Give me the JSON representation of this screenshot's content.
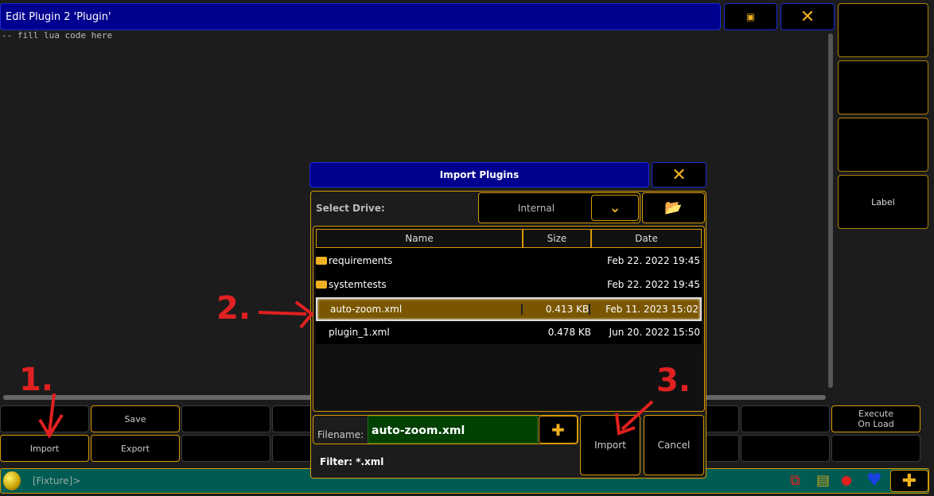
{
  "window": {
    "title": "Edit Plugin 2 'Plugin'",
    "code": "-- fill lua code here"
  },
  "sidebar": {
    "buttons": [
      "",
      "",
      "",
      "Label"
    ]
  },
  "grid": {
    "row1": [
      "",
      "Save",
      "",
      "",
      "",
      "",
      "",
      "",
      "",
      "Execute On Load"
    ],
    "row2": [
      "Import",
      "Export",
      "",
      "",
      "",
      "",
      "",
      "",
      "",
      ""
    ]
  },
  "command_line": {
    "prompt": "[Fixture]>"
  },
  "dialog": {
    "title": "Import Plugins",
    "select_drive_label": "Select Drive:",
    "drive_value": "Internal",
    "columns": [
      "Name",
      "Size",
      "Date"
    ],
    "files": [
      {
        "name": "requirements",
        "size": "",
        "date": "Feb 22. 2022 19:45",
        "type": "folder"
      },
      {
        "name": "systemtests",
        "size": "",
        "date": "Feb 22. 2022 19:45",
        "type": "folder"
      },
      {
        "name": "auto-zoom.xml",
        "size": "0.413 KB",
        "date": "Feb 11. 2023 15:02",
        "type": "file",
        "selected": true
      },
      {
        "name": "plugin_1.xml",
        "size": "0.478 KB",
        "date": "Jun 20. 2022 15:50",
        "type": "file"
      }
    ],
    "filename_label": "Filename:",
    "filename_value": "auto-zoom.xml",
    "filter": "Filter: *.xml",
    "import_label": "Import",
    "cancel_label": "Cancel"
  },
  "annotations": [
    "1.",
    "2.",
    "3."
  ],
  "colors": {
    "accent": "#d89a00",
    "title_blue": "#00008e",
    "selected": "#7a5600",
    "cmd": "#005c52"
  }
}
